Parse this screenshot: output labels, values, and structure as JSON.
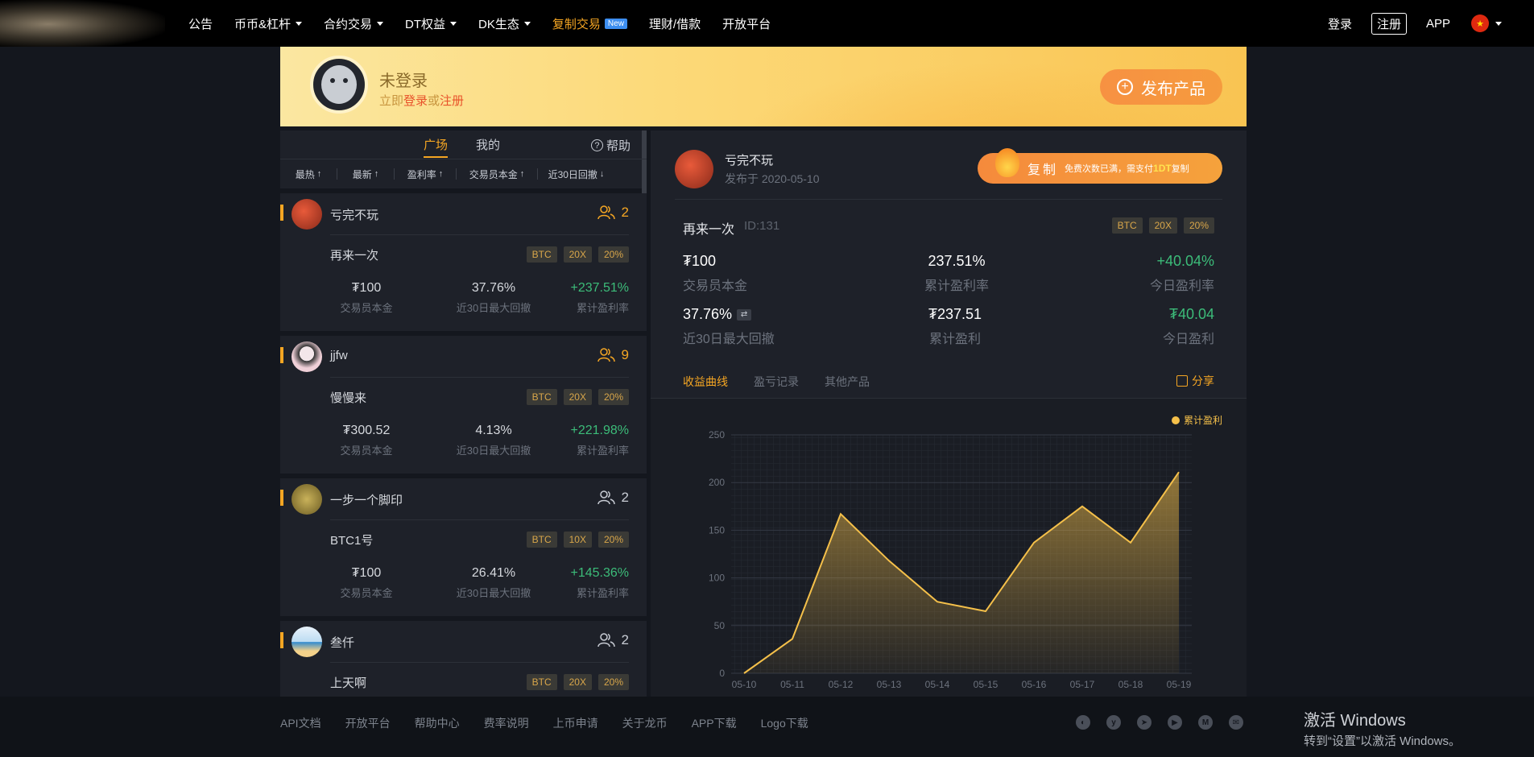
{
  "nav": {
    "items": [
      {
        "label": "公告",
        "caret": false
      },
      {
        "label": "币币&杠杆",
        "caret": true
      },
      {
        "label": "合约交易",
        "caret": true
      },
      {
        "label": "DT权益",
        "caret": true
      },
      {
        "label": "DK生态",
        "caret": true
      },
      {
        "label": "复制交易",
        "caret": false,
        "badge": "New"
      },
      {
        "label": "理财/借款",
        "caret": false
      },
      {
        "label": "开放平台",
        "caret": false
      }
    ],
    "login": "登录",
    "register": "注册",
    "app": "APP",
    "flag_icon": "china-flag-icon"
  },
  "banner": {
    "username": "未登录",
    "prompt_prefix": "立即",
    "login_link": "登录",
    "or": "或",
    "register_link": "注册",
    "publish_label": "发布产品"
  },
  "left": {
    "tabs": [
      "广场",
      "我的"
    ],
    "active_tab": "广场",
    "help": "帮助",
    "sorts": [
      {
        "label": "最热",
        "arrow": "↑"
      },
      {
        "label": "最新",
        "arrow": "↑"
      },
      {
        "label": "盈利率",
        "arrow": "↑"
      },
      {
        "label": "交易员本金",
        "arrow": "↑"
      },
      {
        "label": "近30日回撤",
        "arrow": "↓"
      }
    ],
    "stat_labels": [
      "交易员本金",
      "近30日最大回撤",
      "累计盈利率"
    ],
    "cards": [
      {
        "user": "亏完不玩",
        "followers": "2",
        "product": "再来一次",
        "tags": [
          "BTC",
          "20X",
          "20%"
        ],
        "principal": "₮100",
        "drawdown": "37.76%",
        "profit_rate": "+237.51%"
      },
      {
        "user": "jjfw",
        "followers": "9",
        "product": "慢慢来",
        "tags": [
          "BTC",
          "20X",
          "20%"
        ],
        "principal": "₮300.52",
        "drawdown": "4.13%",
        "profit_rate": "+221.98%"
      },
      {
        "user": "一步一个脚印",
        "followers": "2",
        "product": "BTC1号",
        "tags": [
          "BTC",
          "10X",
          "20%"
        ],
        "principal": "₮100",
        "drawdown": "26.41%",
        "profit_rate": "+145.36%"
      },
      {
        "user": "叁仟",
        "followers": "2",
        "product": "上天啊",
        "tags": [
          "BTC",
          "20X",
          "20%"
        ],
        "principal": "",
        "drawdown": "",
        "profit_rate": ""
      }
    ]
  },
  "detail": {
    "user": "亏完不玩",
    "published": "发布于 2020-05-10",
    "copy_label": "复制",
    "copy_note_prefix": "免费次数已满，需支付",
    "copy_note_amount": "1DT",
    "copy_note_suffix": "复制",
    "product": "再来一次",
    "product_id": "ID:131",
    "tags": [
      "BTC",
      "20X",
      "20%"
    ],
    "stats": [
      {
        "value": "₮100",
        "label": "交易员本金"
      },
      {
        "value": "237.51%",
        "label": "累计盈利率"
      },
      {
        "value": "+40.04%",
        "label": "今日盈利率"
      },
      {
        "value": "37.76%",
        "label": "近30日最大回撤"
      },
      {
        "value": "₮237.51",
        "label": "累计盈利"
      },
      {
        "value": "₮40.04",
        "label": "今日盈利"
      }
    ],
    "tabs": [
      "收益曲线",
      "盈亏记录",
      "其他产品"
    ],
    "share": "分享"
  },
  "chart_data": {
    "type": "area",
    "categories": [
      "05-10",
      "05-11",
      "05-12",
      "05-13",
      "05-14",
      "05-15",
      "05-16",
      "05-17",
      "05-18",
      "05-19"
    ],
    "series": [
      {
        "name": "累计盈利",
        "values": [
          0,
          36,
          167,
          118,
          75,
          65,
          137,
          175,
          137,
          211
        ]
      }
    ],
    "ylim": [
      0,
      250
    ],
    "yticks": [
      0,
      50,
      100,
      150,
      200,
      250
    ],
    "legend": "top-right",
    "grid": true,
    "color": "#f5c04a"
  },
  "footer": {
    "links": [
      "API文档",
      "开放平台",
      "帮助中心",
      "费率说明",
      "上币申请",
      "关于龙币",
      "APP下载",
      "Logo下载"
    ],
    "socials": [
      "wechat-icon",
      "twitter-icon",
      "telegram-icon",
      "youtube-icon",
      "medium-icon",
      "mail-icon"
    ]
  },
  "windows": {
    "line1": "激活 Windows",
    "line2": "转到“设置”以激活 Windows。"
  }
}
